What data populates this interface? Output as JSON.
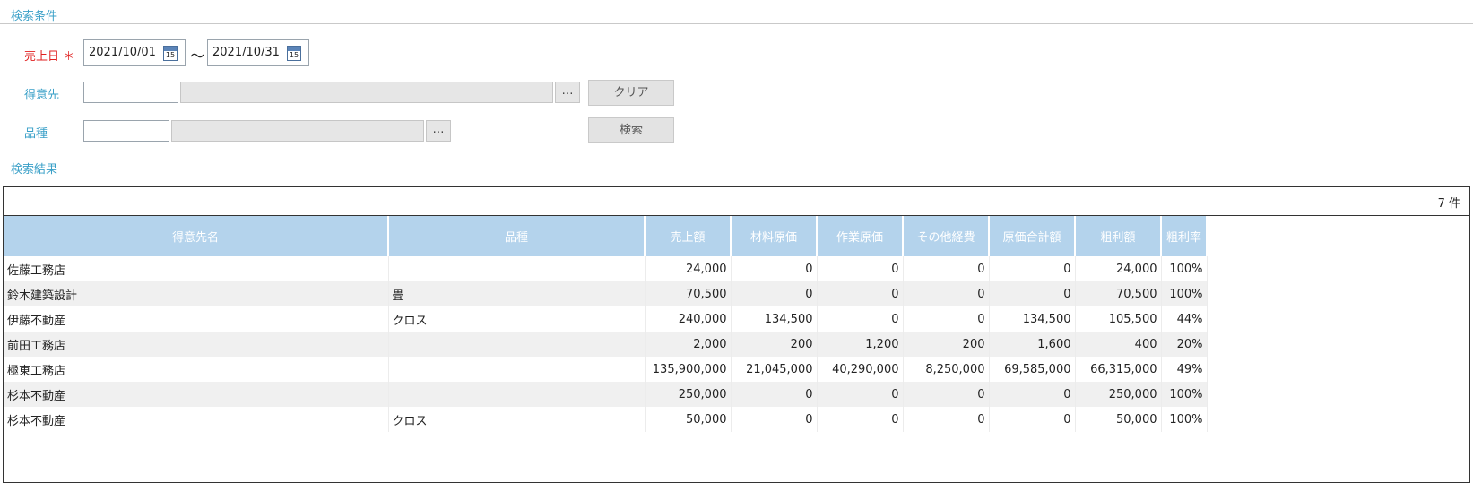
{
  "search": {
    "title": "検索条件",
    "sales_date": {
      "label": "売上日",
      "required_mark": "＊",
      "from": "2021/10/01",
      "to": "2021/10/31",
      "separator": "～",
      "calendar_day": "15"
    },
    "customer": {
      "label": "得意先",
      "code": "",
      "name": "",
      "lookup_label": "…"
    },
    "product": {
      "label": "品種",
      "code": "",
      "name": "",
      "lookup_label": "…"
    },
    "clear_label": "クリア",
    "search_label": "検索"
  },
  "results": {
    "title": "検索結果",
    "count": "7",
    "count_unit": "件",
    "columns": [
      "得意先名",
      "品種",
      "売上額",
      "材料原価",
      "作業原価",
      "その他経費",
      "原価合計額",
      "粗利額",
      "粗利率"
    ],
    "rows": [
      [
        "佐藤工務店",
        "",
        "24,000",
        "0",
        "0",
        "0",
        "0",
        "24,000",
        "100%"
      ],
      [
        "鈴木建築設計",
        "畳",
        "70,500",
        "0",
        "0",
        "0",
        "0",
        "70,500",
        "100%"
      ],
      [
        "伊藤不動産",
        "クロス",
        "240,000",
        "134,500",
        "0",
        "0",
        "134,500",
        "105,500",
        "44%"
      ],
      [
        "前田工務店",
        "",
        "2,000",
        "200",
        "1,200",
        "200",
        "1,600",
        "400",
        "20%"
      ],
      [
        "極東工務店",
        "",
        "135,900,000",
        "21,045,000",
        "40,290,000",
        "8,250,000",
        "69,585,000",
        "66,315,000",
        "49%"
      ],
      [
        "杉本不動産",
        "",
        "250,000",
        "0",
        "0",
        "0",
        "0",
        "250,000",
        "100%"
      ],
      [
        "杉本不動産",
        "クロス",
        "50,000",
        "0",
        "0",
        "0",
        "0",
        "50,000",
        "100%"
      ]
    ]
  }
}
